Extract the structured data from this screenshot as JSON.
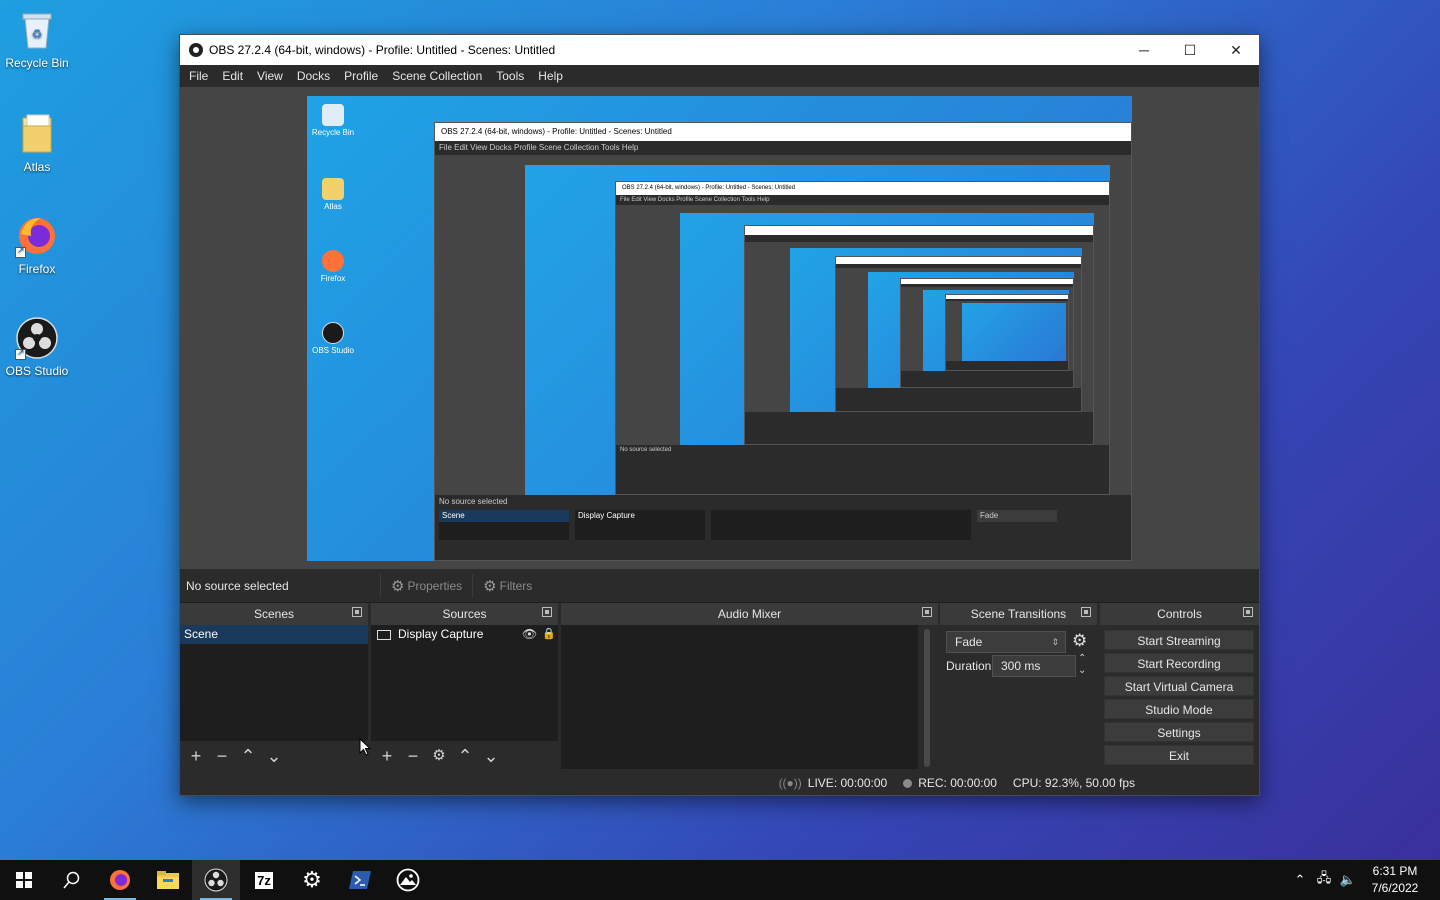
{
  "desktop": {
    "icons": [
      {
        "label": "Recycle Bin",
        "icon": "recycle-bin-icon"
      },
      {
        "label": "Atlas",
        "icon": "folder-icon"
      },
      {
        "label": "Firefox",
        "icon": "firefox-icon"
      },
      {
        "label": "OBS Studio",
        "icon": "obs-icon"
      }
    ]
  },
  "window": {
    "title": "OBS 27.2.4 (64-bit, windows) - Profile: Untitled - Scenes: Untitled",
    "controls": {
      "minimize": "─",
      "maximize": "☐",
      "close": "✕"
    }
  },
  "menu": [
    "File",
    "Edit",
    "View",
    "Docks",
    "Profile",
    "Scene Collection",
    "Tools",
    "Help"
  ],
  "source_bar": {
    "status": "No source selected",
    "properties": "Properties",
    "filters": "Filters"
  },
  "docks": {
    "scenes": {
      "title": "Scenes",
      "items": [
        "Scene"
      ]
    },
    "sources": {
      "title": "Sources",
      "items": [
        "Display Capture"
      ]
    },
    "audio_mixer": {
      "title": "Audio Mixer"
    },
    "transitions": {
      "title": "Scene Transitions",
      "transition": "Fade",
      "duration_label": "Duration",
      "duration_value": "300 ms"
    },
    "controls": {
      "title": "Controls",
      "buttons": [
        "Start Streaming",
        "Start Recording",
        "Start Virtual Camera",
        "Studio Mode",
        "Settings",
        "Exit"
      ]
    }
  },
  "status": {
    "live": "LIVE: 00:00:00",
    "rec": "REC: 00:00:00",
    "cpu": "CPU: 92.3%, 50.00 fps"
  },
  "nested": {
    "title": "OBS 27.2.4 (64-bit, windows) - Profile: Untitled - Scenes: Untitled",
    "menu": "File   Edit   View   Docks   Profile   Scene Collection   Tools   Help",
    "status": "No source selected",
    "scene": "Scene",
    "source": "Display Capture",
    "fade": "Fade"
  },
  "taskbar": {
    "apps": [
      "start",
      "search",
      "firefox",
      "file-explorer",
      "obs",
      "7zip",
      "settings",
      "powershell",
      "photos"
    ],
    "clock_time": "6:31 PM",
    "clock_date": "7/6/2022"
  },
  "colors": {
    "obs_bg": "#2b2b2b",
    "dock_header": "#3a3a3a",
    "list_bg": "#1e1e1e",
    "selected": "#1a3a5c",
    "desktop": "#2a7fd6"
  }
}
